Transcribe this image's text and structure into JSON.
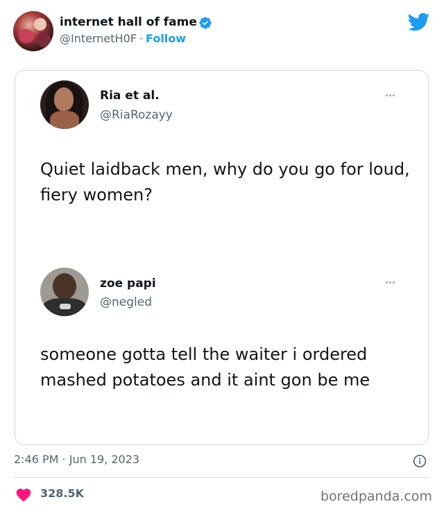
{
  "account": {
    "name": "internet hall of fame",
    "handle": "@InternetH0F",
    "separator": "·",
    "follow_label": "Follow"
  },
  "colors": {
    "accent": "#1d9bf0",
    "verified": "#1d9bf0",
    "heart": "#f91880",
    "muted_text": "#536471",
    "border": "#cfd9de"
  },
  "icons": {
    "brand": "twitter-bird-icon",
    "verified": "verified-badge-icon",
    "more": "more-dots-icon",
    "info": "info-icon",
    "like": "heart-icon"
  },
  "embedded": {
    "tweets": [
      {
        "name": "Ria et al.",
        "handle": "@RiaRozayy",
        "text": "Quiet laidback men, why do you go for loud, fiery women?"
      },
      {
        "name": "zoe papi",
        "handle": "@negled",
        "text": "someone gotta tell the waiter i ordered mashed potatoes and it aint gon be me"
      }
    ]
  },
  "meta": {
    "timestamp": "2:46 PM · Jun 19, 2023",
    "likes": "328.5K"
  },
  "watermark": "boredpanda.com"
}
